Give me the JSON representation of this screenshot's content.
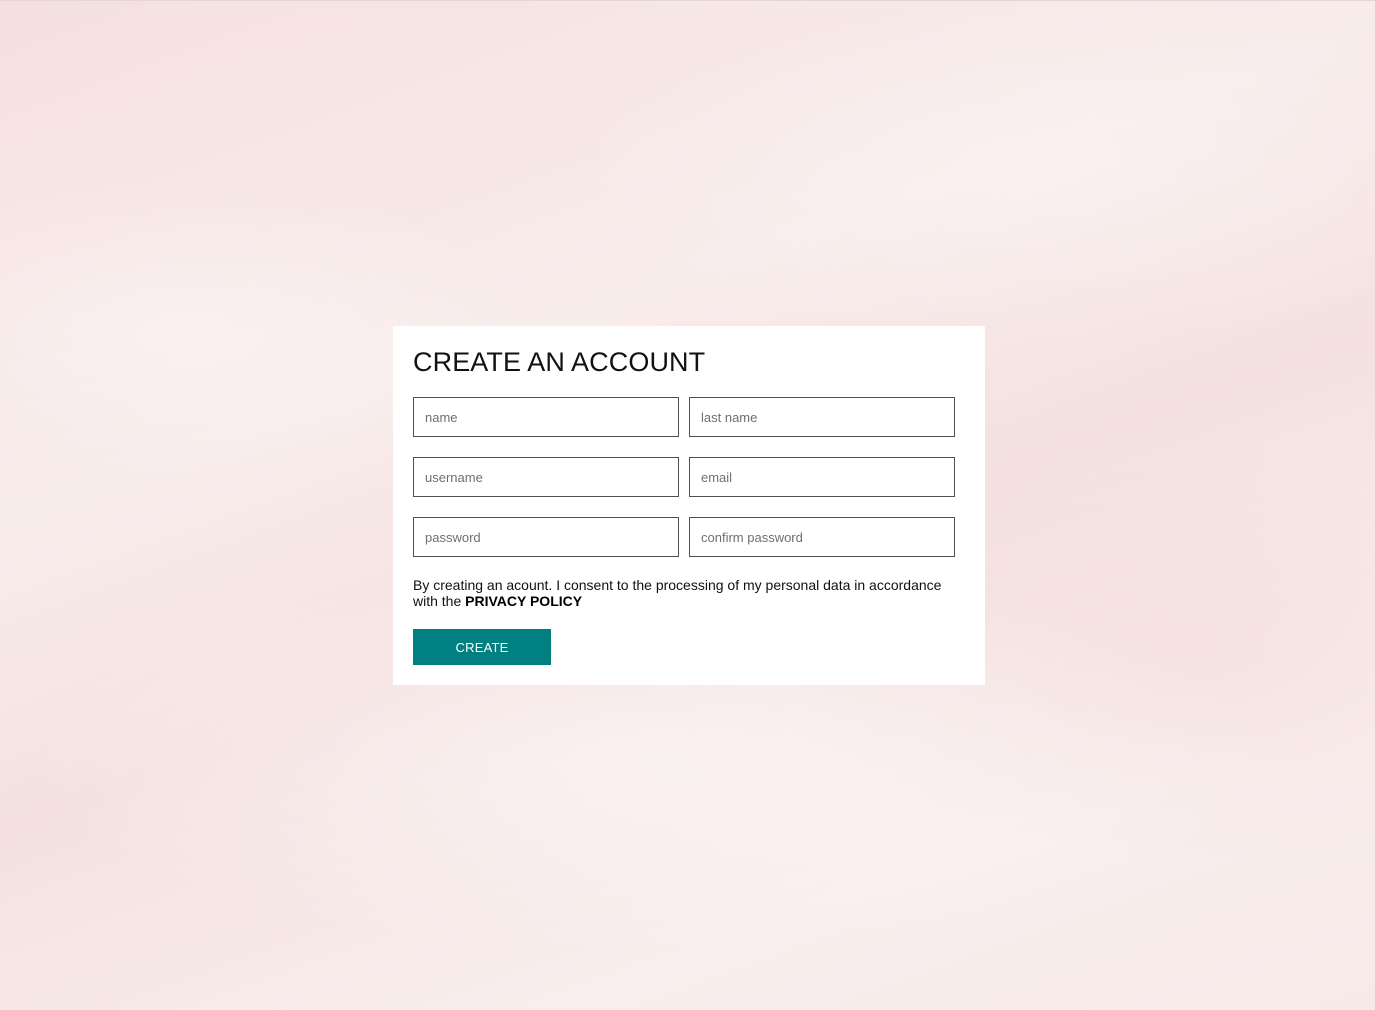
{
  "form": {
    "title": "CREATE AN ACCOUNT",
    "fields": {
      "name": {
        "placeholder": "name",
        "value": ""
      },
      "last_name": {
        "placeholder": "last name",
        "value": ""
      },
      "username": {
        "placeholder": "username",
        "value": ""
      },
      "email": {
        "placeholder": "email",
        "value": ""
      },
      "password": {
        "placeholder": "password",
        "value": ""
      },
      "confirm_password": {
        "placeholder": "confirm password",
        "value": ""
      }
    },
    "consent_text": "By creating an acount. I consent to the processing of my personal data in accordance with the ",
    "privacy_link": "PRIVACY POLICY",
    "submit_label": "CREATE"
  },
  "colors": {
    "accent": "#008080",
    "background": "#f7e7e6",
    "card": "#ffffff"
  }
}
